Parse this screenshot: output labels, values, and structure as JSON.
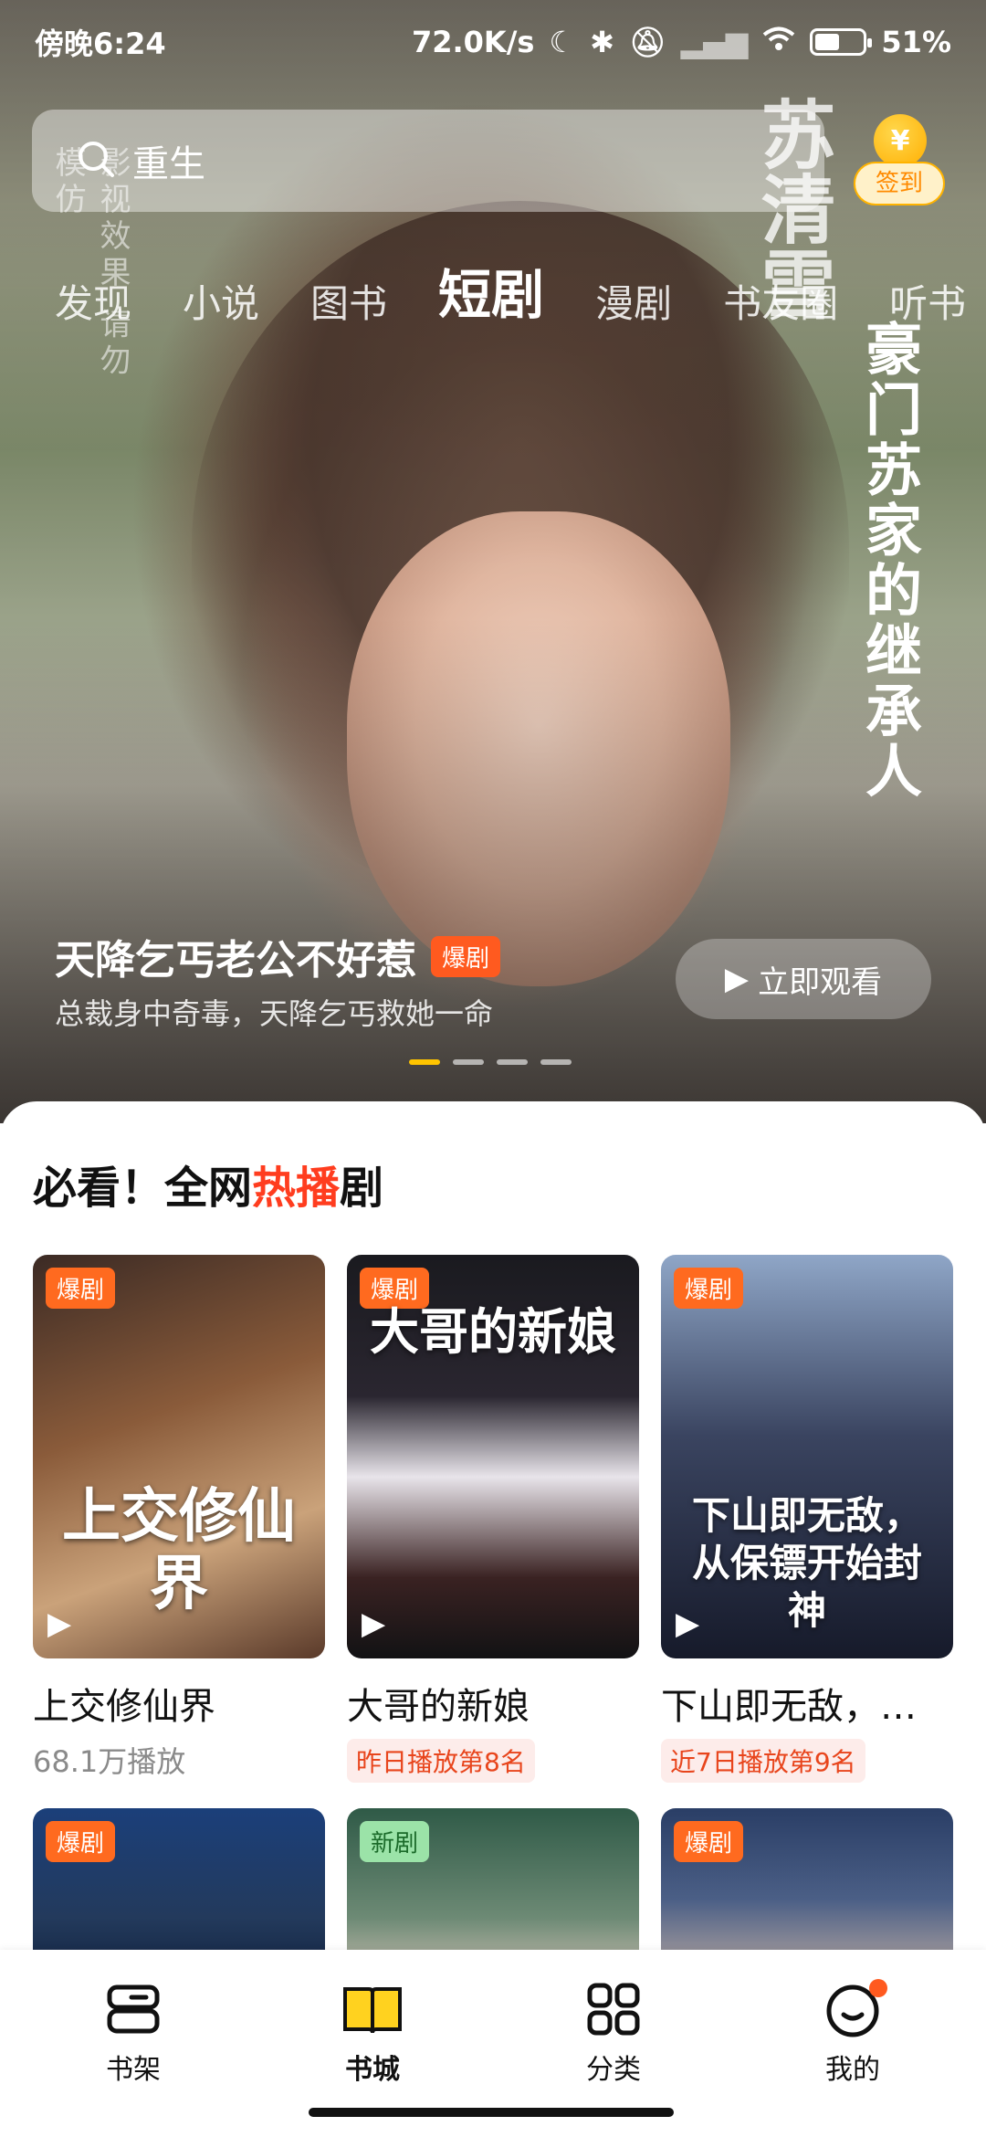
{
  "status_bar": {
    "time": "傍晚6:24",
    "network_speed": "72.0K/s",
    "battery_percent": "51%",
    "battery_level": 0.51
  },
  "search": {
    "query": "重生"
  },
  "signin": {
    "label": "签到",
    "coin_symbol": "¥"
  },
  "poster_overlay": {
    "watermark": "影视效果 请勿模仿",
    "character_name": "苏清雪",
    "character_role": "豪门苏家的继承人"
  },
  "tabs": [
    "发现",
    "小说",
    "图书",
    "短剧",
    "漫剧",
    "书友圈",
    "听书"
  ],
  "active_tab": "短剧",
  "hero": {
    "title": "天降乞丐老公不好惹",
    "badge": "爆剧",
    "subtitle": "总裁身中奇毒，天降乞丐救她一命",
    "watch_button": "立即观看",
    "carousel_count": 4,
    "carousel_active": 1
  },
  "section": {
    "title_prefix": "必看！全网",
    "title_hot": "热播",
    "title_suffix": "剧"
  },
  "cards": [
    {
      "badge": "爆剧",
      "cover_title": "上交修仙界",
      "name": "上交修仙界",
      "meta": "68.1万播放",
      "rank": ""
    },
    {
      "badge": "爆剧",
      "cover_title": "大哥的新娘",
      "name": "大哥的新娘",
      "meta": "",
      "rank": "昨日播放第8名"
    },
    {
      "badge": "爆剧",
      "cover_title": "下山即无敌，从保镖开始封神",
      "name": "下山即无敌，…",
      "meta": "",
      "rank": "近7日播放第9名"
    },
    {
      "badge": "爆剧",
      "cover_title": "",
      "name": "",
      "meta": "",
      "rank": ""
    },
    {
      "badge": "新剧",
      "cover_title": "",
      "name": "",
      "meta": "",
      "rank": ""
    },
    {
      "badge": "爆剧",
      "cover_title": "",
      "name": "",
      "meta": "",
      "rank": ""
    }
  ],
  "bottom_nav": [
    {
      "label": "书架",
      "icon": "bookshelf-icon"
    },
    {
      "label": "书城",
      "icon": "bookstore-icon",
      "active": true
    },
    {
      "label": "分类",
      "icon": "category-icon"
    },
    {
      "label": "我的",
      "icon": "profile-icon",
      "notification_dot": true
    }
  ],
  "colors": {
    "accent": "#ffc400",
    "hot": "#ff3d1f",
    "badge_orange": "#ff6a1f",
    "badge_new": "#9be3a8"
  }
}
